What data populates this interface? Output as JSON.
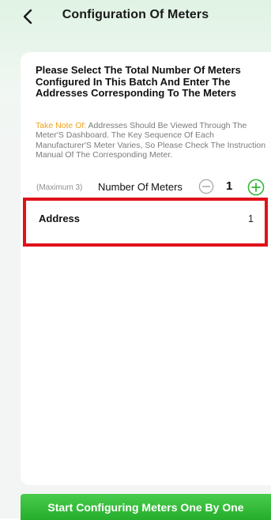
{
  "header": {
    "title": "Configuration Of Meters",
    "back_icon": "chevron-left-icon"
  },
  "instructions": {
    "headline": "Please Select The Total Number Of Meters Configured In This Batch And Enter The Addresses Corresponding To The Meters",
    "note_key": "Take Note Of:",
    "note_body": " Addresses Should Be Viewed Through The Meter'S Dashboard. The Key Sequence Of Each Manufacturer'S Meter Varies, So Please Check The Instruction Manual Of The Corresponding Meter."
  },
  "counter": {
    "max_label": "(Maximum 3)",
    "label": "Number Of Meters",
    "value": "1",
    "minus_icon": "minus-circle-icon",
    "plus_icon": "plus-circle-icon"
  },
  "address": {
    "label": "Address",
    "value": "1"
  },
  "footer": {
    "button_label": "Start Configuring Meters One By One"
  },
  "colors": {
    "accent_green": "#2fb536",
    "note_orange": "#f0a21b",
    "highlight_red": "#e0121a"
  }
}
